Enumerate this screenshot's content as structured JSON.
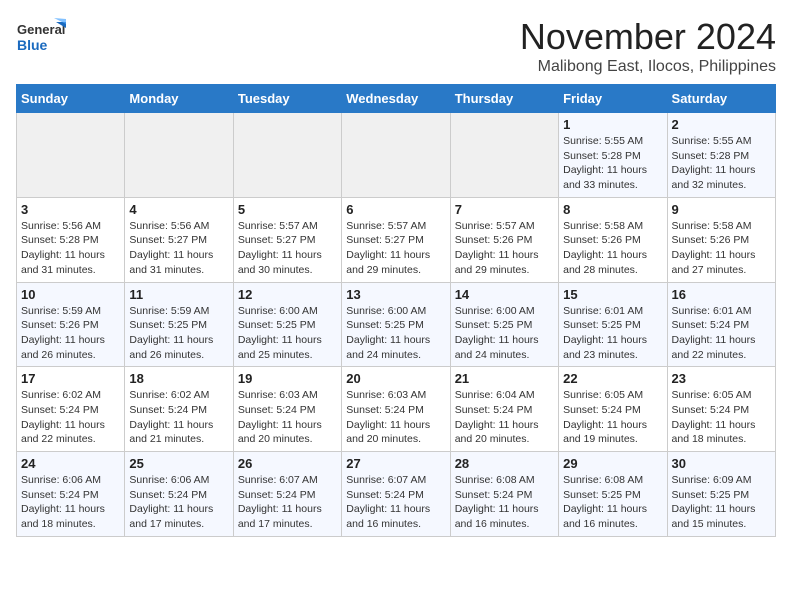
{
  "logo": {
    "line1": "General",
    "line2": "Blue"
  },
  "title": "November 2024",
  "location": "Malibong East, Ilocos, Philippines",
  "weekdays": [
    "Sunday",
    "Monday",
    "Tuesday",
    "Wednesday",
    "Thursday",
    "Friday",
    "Saturday"
  ],
  "weeks": [
    [
      {
        "day": "",
        "info": ""
      },
      {
        "day": "",
        "info": ""
      },
      {
        "day": "",
        "info": ""
      },
      {
        "day": "",
        "info": ""
      },
      {
        "day": "",
        "info": ""
      },
      {
        "day": "1",
        "info": "Sunrise: 5:55 AM\nSunset: 5:28 PM\nDaylight: 11 hours and 33 minutes."
      },
      {
        "day": "2",
        "info": "Sunrise: 5:55 AM\nSunset: 5:28 PM\nDaylight: 11 hours and 32 minutes."
      }
    ],
    [
      {
        "day": "3",
        "info": "Sunrise: 5:56 AM\nSunset: 5:28 PM\nDaylight: 11 hours and 31 minutes."
      },
      {
        "day": "4",
        "info": "Sunrise: 5:56 AM\nSunset: 5:27 PM\nDaylight: 11 hours and 31 minutes."
      },
      {
        "day": "5",
        "info": "Sunrise: 5:57 AM\nSunset: 5:27 PM\nDaylight: 11 hours and 30 minutes."
      },
      {
        "day": "6",
        "info": "Sunrise: 5:57 AM\nSunset: 5:27 PM\nDaylight: 11 hours and 29 minutes."
      },
      {
        "day": "7",
        "info": "Sunrise: 5:57 AM\nSunset: 5:26 PM\nDaylight: 11 hours and 29 minutes."
      },
      {
        "day": "8",
        "info": "Sunrise: 5:58 AM\nSunset: 5:26 PM\nDaylight: 11 hours and 28 minutes."
      },
      {
        "day": "9",
        "info": "Sunrise: 5:58 AM\nSunset: 5:26 PM\nDaylight: 11 hours and 27 minutes."
      }
    ],
    [
      {
        "day": "10",
        "info": "Sunrise: 5:59 AM\nSunset: 5:26 PM\nDaylight: 11 hours and 26 minutes."
      },
      {
        "day": "11",
        "info": "Sunrise: 5:59 AM\nSunset: 5:25 PM\nDaylight: 11 hours and 26 minutes."
      },
      {
        "day": "12",
        "info": "Sunrise: 6:00 AM\nSunset: 5:25 PM\nDaylight: 11 hours and 25 minutes."
      },
      {
        "day": "13",
        "info": "Sunrise: 6:00 AM\nSunset: 5:25 PM\nDaylight: 11 hours and 24 minutes."
      },
      {
        "day": "14",
        "info": "Sunrise: 6:00 AM\nSunset: 5:25 PM\nDaylight: 11 hours and 24 minutes."
      },
      {
        "day": "15",
        "info": "Sunrise: 6:01 AM\nSunset: 5:25 PM\nDaylight: 11 hours and 23 minutes."
      },
      {
        "day": "16",
        "info": "Sunrise: 6:01 AM\nSunset: 5:24 PM\nDaylight: 11 hours and 22 minutes."
      }
    ],
    [
      {
        "day": "17",
        "info": "Sunrise: 6:02 AM\nSunset: 5:24 PM\nDaylight: 11 hours and 22 minutes."
      },
      {
        "day": "18",
        "info": "Sunrise: 6:02 AM\nSunset: 5:24 PM\nDaylight: 11 hours and 21 minutes."
      },
      {
        "day": "19",
        "info": "Sunrise: 6:03 AM\nSunset: 5:24 PM\nDaylight: 11 hours and 20 minutes."
      },
      {
        "day": "20",
        "info": "Sunrise: 6:03 AM\nSunset: 5:24 PM\nDaylight: 11 hours and 20 minutes."
      },
      {
        "day": "21",
        "info": "Sunrise: 6:04 AM\nSunset: 5:24 PM\nDaylight: 11 hours and 20 minutes."
      },
      {
        "day": "22",
        "info": "Sunrise: 6:05 AM\nSunset: 5:24 PM\nDaylight: 11 hours and 19 minutes."
      },
      {
        "day": "23",
        "info": "Sunrise: 6:05 AM\nSunset: 5:24 PM\nDaylight: 11 hours and 18 minutes."
      }
    ],
    [
      {
        "day": "24",
        "info": "Sunrise: 6:06 AM\nSunset: 5:24 PM\nDaylight: 11 hours and 18 minutes."
      },
      {
        "day": "25",
        "info": "Sunrise: 6:06 AM\nSunset: 5:24 PM\nDaylight: 11 hours and 17 minutes."
      },
      {
        "day": "26",
        "info": "Sunrise: 6:07 AM\nSunset: 5:24 PM\nDaylight: 11 hours and 17 minutes."
      },
      {
        "day": "27",
        "info": "Sunrise: 6:07 AM\nSunset: 5:24 PM\nDaylight: 11 hours and 16 minutes."
      },
      {
        "day": "28",
        "info": "Sunrise: 6:08 AM\nSunset: 5:24 PM\nDaylight: 11 hours and 16 minutes."
      },
      {
        "day": "29",
        "info": "Sunrise: 6:08 AM\nSunset: 5:25 PM\nDaylight: 11 hours and 16 minutes."
      },
      {
        "day": "30",
        "info": "Sunrise: 6:09 AM\nSunset: 5:25 PM\nDaylight: 11 hours and 15 minutes."
      }
    ]
  ]
}
